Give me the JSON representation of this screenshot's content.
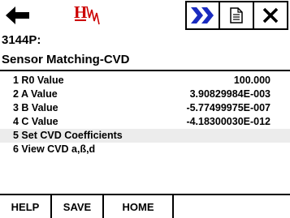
{
  "toolbar": {
    "back_icon": "arrow-left-icon",
    "logo_text": "H",
    "logo_icon": "hart-logo-icon",
    "fast_forward_icon": "double-chevron-right-icon",
    "page_icon": "document-icon",
    "close_icon": "close-icon",
    "accent_color": "#cc0000",
    "icon_blue": "#1a2bbf"
  },
  "header": {
    "tag": "3144P:",
    "title": "Sensor Matching-CVD"
  },
  "menu": {
    "items": [
      {
        "label": "1 R0 Value",
        "value": "100.000"
      },
      {
        "label": "2 A Value",
        "value": "3.90829984E-003"
      },
      {
        "label": "3 B Value",
        "value": "-5.77499975E-007"
      },
      {
        "label": "4 C Value",
        "value": "-4.18300030E-012"
      },
      {
        "label": "5 Set CVD Coefficients",
        "value": ""
      },
      {
        "label": "6 View CVD a,ß,d",
        "value": ""
      }
    ],
    "selected_index": 4
  },
  "function_keys": {
    "help": "HELP",
    "save": "SAVE",
    "home": "HOME"
  }
}
